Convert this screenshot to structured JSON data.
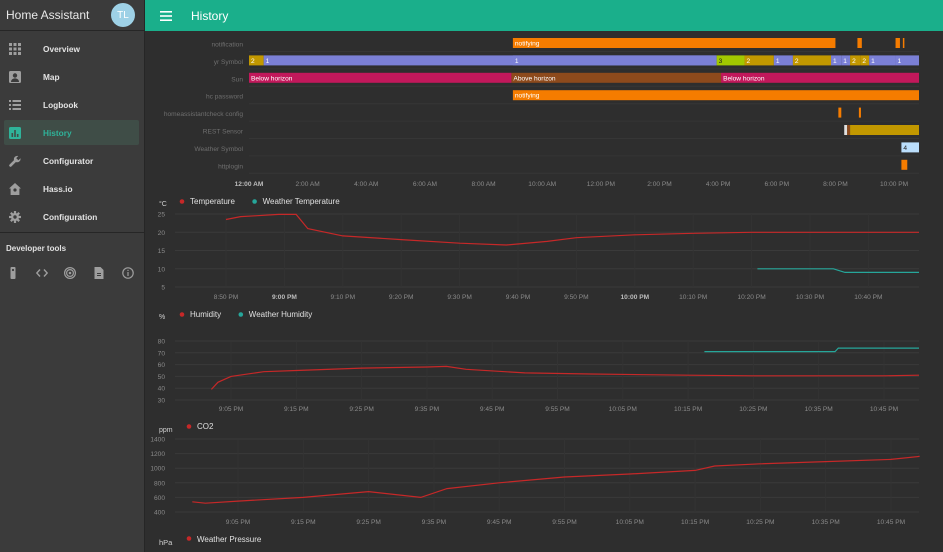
{
  "sidebar": {
    "app_title": "Home Assistant",
    "avatar_initials": "TL",
    "items": [
      {
        "label": "Overview",
        "icon": "apps-icon"
      },
      {
        "label": "Map",
        "icon": "account-box-icon"
      },
      {
        "label": "Logbook",
        "icon": "list-icon"
      },
      {
        "label": "History",
        "icon": "chart-box-icon",
        "active": true
      },
      {
        "label": "Configurator",
        "icon": "wrench-icon"
      },
      {
        "label": "Hass.io",
        "icon": "home-assistant-icon"
      },
      {
        "label": "Configuration",
        "icon": "gear-icon"
      }
    ],
    "dev_tools_label": "Developer tools",
    "dev_tools": [
      "remote-icon",
      "code-icon",
      "broadcast-icon",
      "file-icon",
      "info-icon"
    ]
  },
  "toolbar": {
    "title": "History"
  },
  "colors": {
    "accent": "#1aaf8b",
    "active_nav": "#2fb39a",
    "line_red": "#c62828",
    "line_teal": "#26a69a",
    "orange": "#f57c00",
    "lavender": "#7b80d6",
    "magenta": "#c2185b",
    "brown": "#8d4a1c",
    "gold": "#c29800",
    "lime": "#a2c800",
    "pale_blue": "#bbdefb"
  },
  "timeline": {
    "x_labels": [
      "12:00 AM",
      "2:00 AM",
      "4:00 AM",
      "6:00 AM",
      "8:00 AM",
      "10:00 AM",
      "12:00 PM",
      "2:00 PM",
      "4:00 PM",
      "6:00 PM",
      "8:00 PM",
      "10:00 PM"
    ],
    "rows": [
      {
        "name": "notification",
        "segments": [
          {
            "from": 9,
            "to": 20,
            "label": "notifying",
            "color": "#f57c00"
          },
          {
            "from": 20.75,
            "to": 20.9,
            "label": "",
            "color": "#f57c00"
          },
          {
            "from": 22.05,
            "to": 22.2,
            "label": "",
            "color": "#f57c00"
          },
          {
            "from": 22.3,
            "to": 22.35,
            "label": "",
            "color": "#f57c00"
          }
        ]
      },
      {
        "name": "yr Symbol",
        "segments": [
          {
            "from": 0,
            "to": 0.5,
            "label": "2",
            "color": "#c29800"
          },
          {
            "from": 0.5,
            "to": 15.95,
            "label": "1",
            "color": "#7b80d6"
          },
          {
            "from": 9,
            "to": 15.95,
            "label": "1",
            "color": "#7b80d6"
          },
          {
            "from": 15.95,
            "to": 16.9,
            "label": "3",
            "color": "#a2c800"
          },
          {
            "from": 16.9,
            "to": 17.9,
            "label": "2",
            "color": "#c29800"
          },
          {
            "from": 17.9,
            "to": 18.55,
            "label": "1",
            "color": "#7b80d6"
          },
          {
            "from": 18.55,
            "to": 19.85,
            "label": "2",
            "color": "#c29800"
          },
          {
            "from": 19.85,
            "to": 20.2,
            "label": "1",
            "color": "#7b80d6"
          },
          {
            "from": 20.2,
            "to": 20.5,
            "label": "1",
            "color": "#7b80d6"
          },
          {
            "from": 20.5,
            "to": 20.85,
            "label": "2",
            "color": "#c29800"
          },
          {
            "from": 20.85,
            "to": 21.15,
            "label": "2",
            "color": "#c29800"
          },
          {
            "from": 21.15,
            "to": 22.05,
            "label": "1",
            "color": "#7b80d6"
          },
          {
            "from": 22.05,
            "to": 22.85,
            "label": "1",
            "color": "#7b80d6"
          }
        ]
      },
      {
        "name": "Sun",
        "segments": [
          {
            "from": 0,
            "to": 8.95,
            "label": "Below horizon",
            "color": "#c2185b"
          },
          {
            "from": 8.95,
            "to": 16.1,
            "label": "Above horizon",
            "color": "#8d4a1c"
          },
          {
            "from": 16.1,
            "to": 22.85,
            "label": "Below horizon",
            "color": "#c2185b"
          }
        ]
      },
      {
        "name": "hc password",
        "segments": [
          {
            "from": 9,
            "to": 22.85,
            "label": "notifying",
            "color": "#f57c00"
          }
        ]
      },
      {
        "name": "homeassistantcheck config",
        "segments": [
          {
            "from": 20.1,
            "to": 20.2,
            "label": "",
            "color": "#f57c00"
          },
          {
            "from": 20.8,
            "to": 20.87,
            "label": "",
            "color": "#f57c00"
          }
        ]
      },
      {
        "name": "REST Sensor",
        "segments": [
          {
            "from": 20.3,
            "to": 20.4,
            "label": "",
            "color": "#e0e0e0"
          },
          {
            "from": 20.4,
            "to": 20.5,
            "label": "",
            "color": "#8d4a1c"
          },
          {
            "from": 20.5,
            "to": 22.85,
            "label": "",
            "color": "#c29800"
          }
        ]
      },
      {
        "name": "Weather Symbol",
        "segments": [
          {
            "from": 22.25,
            "to": 22.85,
            "label": "4",
            "color": "#bbdefb"
          }
        ]
      },
      {
        "name": "httplogin",
        "segments": [
          {
            "from": 22.25,
            "to": 22.45,
            "label": "",
            "color": "#f57c00"
          }
        ]
      }
    ]
  },
  "chart_data": [
    {
      "type": "line",
      "unit": "°C",
      "x_labels": [
        "8:50 PM",
        "9:00 PM",
        "9:10 PM",
        "9:20 PM",
        "9:30 PM",
        "9:40 PM",
        "9:50 PM",
        "10:00 PM",
        "10:10 PM",
        "10:20 PM",
        "10:30 PM",
        "10:40 PM"
      ],
      "y_ticks": [
        25,
        20,
        15,
        10,
        5
      ],
      "ylim": [
        5,
        25
      ],
      "series": [
        {
          "name": "Temperature",
          "color": "#c62828",
          "points": [
            [
              0,
              23.5
            ],
            [
              0.25,
              24.3
            ],
            [
              0.5,
              24.5
            ],
            [
              0.9,
              24.9
            ],
            [
              1.2,
              24.9
            ],
            [
              1.4,
              21
            ],
            [
              2,
              19
            ],
            [
              3,
              18
            ],
            [
              4,
              17
            ],
            [
              4.8,
              16.5
            ],
            [
              5.5,
              17.5
            ],
            [
              6,
              18.5
            ],
            [
              7,
              19.3
            ],
            [
              8,
              19.7
            ],
            [
              9,
              20
            ],
            [
              10,
              20
            ],
            [
              11,
              20
            ],
            [
              12.1,
              20
            ]
          ]
        },
        {
          "name": "Weather Temperature",
          "color": "#26a69a",
          "points": [
            [
              9.1,
              10
            ],
            [
              10.4,
              10
            ],
            [
              10.6,
              9
            ],
            [
              11.5,
              9
            ],
            [
              12.1,
              9
            ]
          ]
        }
      ]
    },
    {
      "type": "line",
      "unit": "%",
      "x_labels": [
        "9:05 PM",
        "9:15 PM",
        "9:25 PM",
        "9:35 PM",
        "9:45 PM",
        "9:55 PM",
        "10:05 PM",
        "10:15 PM",
        "10:25 PM",
        "10:35 PM",
        "10:45 PM"
      ],
      "y_ticks": [
        80,
        70,
        60,
        50,
        40,
        30
      ],
      "ylim": [
        30,
        80
      ],
      "series": [
        {
          "name": "Humidity",
          "color": "#c62828",
          "points": [
            [
              -0.3,
              39
            ],
            [
              -0.2,
              45
            ],
            [
              0,
              50
            ],
            [
              0.5,
              54
            ],
            [
              1,
              55
            ],
            [
              2,
              57
            ],
            [
              3,
              58
            ],
            [
              3.3,
              58.5
            ],
            [
              3.6,
              56
            ],
            [
              4.5,
              53
            ],
            [
              5.5,
              52
            ],
            [
              7,
              51
            ],
            [
              8,
              50.5
            ],
            [
              9,
              50.5
            ],
            [
              10,
              50.5
            ],
            [
              11.05,
              51
            ]
          ]
        },
        {
          "name": "Weather Humidity",
          "color": "#26a69a",
          "points": [
            [
              7.25,
              71
            ],
            [
              9.25,
              71
            ],
            [
              9.3,
              74
            ],
            [
              11.05,
              74
            ]
          ]
        }
      ]
    },
    {
      "type": "line",
      "unit": "ppm",
      "x_labels": [
        "9:05 PM",
        "9:15 PM",
        "9:25 PM",
        "9:35 PM",
        "9:45 PM",
        "9:55 PM",
        "10:05 PM",
        "10:15 PM",
        "10:25 PM",
        "10:35 PM",
        "10:45 PM"
      ],
      "y_ticks": [
        1400,
        1200,
        1000,
        800,
        600,
        400
      ],
      "ylim": [
        400,
        1400
      ],
      "series": [
        {
          "name": "CO2",
          "color": "#c62828",
          "points": [
            [
              -0.7,
              540
            ],
            [
              -0.5,
              520
            ],
            [
              0,
              550
            ],
            [
              1,
              600
            ],
            [
              2,
              680
            ],
            [
              2.8,
              600
            ],
            [
              3.2,
              720
            ],
            [
              4,
              800
            ],
            [
              5,
              880
            ],
            [
              6,
              920
            ],
            [
              7,
              970
            ],
            [
              7.3,
              1030
            ],
            [
              8,
              1060
            ],
            [
              9,
              1090
            ],
            [
              10,
              1120
            ],
            [
              10.5,
              1160
            ],
            [
              11.1,
              1170
            ]
          ]
        }
      ]
    }
  ],
  "pressure_legend": {
    "unit": "hPa",
    "name": "Weather Pressure"
  }
}
